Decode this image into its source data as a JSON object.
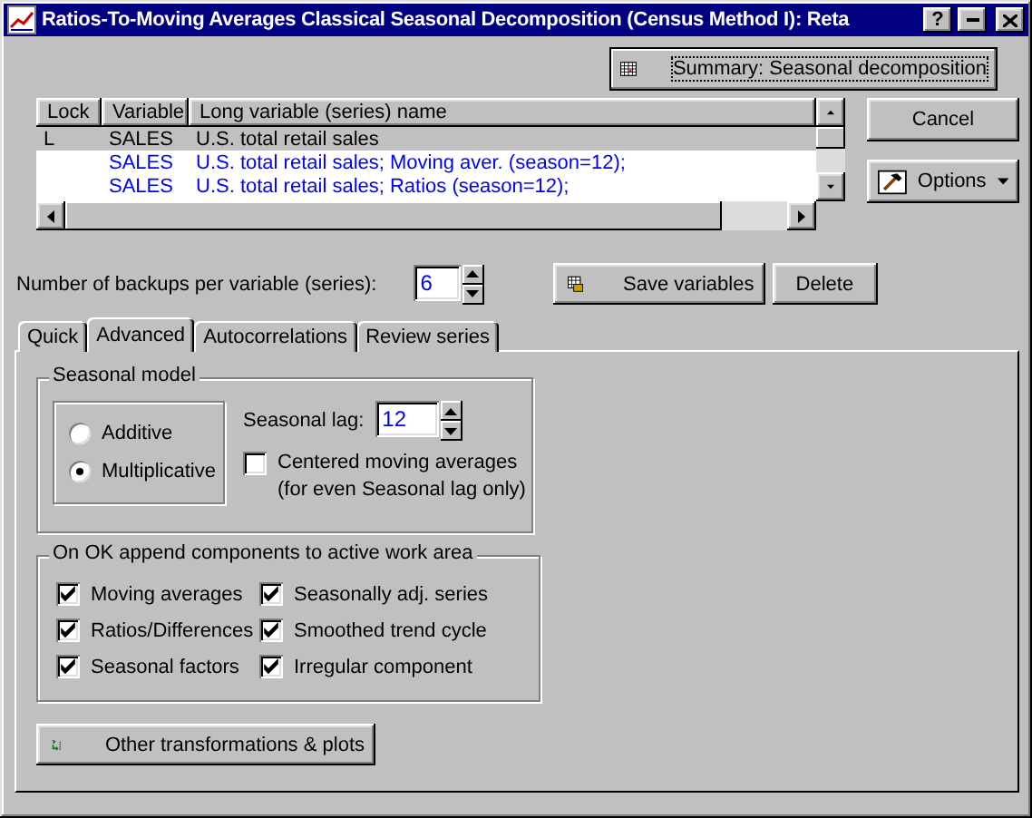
{
  "window": {
    "title": "Ratios-To-Moving Averages Classical Seasonal Decomposition (Census Method I): Reta",
    "help": "?"
  },
  "summary_button": "Summary:  Seasonal decomposition",
  "variables": {
    "columns": [
      "Lock",
      "Variable",
      "Long variable (series) name"
    ],
    "rows": [
      {
        "lock": "L",
        "variable": "SALES",
        "name": "U.S. total retail sales",
        "kind": "original",
        "selected": true
      },
      {
        "variable": "SALES",
        "name": "U.S. total retail sales; Moving aver. (season=12);",
        "kind": "new",
        "selected": false
      },
      {
        "variable": "SALES",
        "name": "U.S. total retail sales; Ratios (season=12);",
        "kind": "new",
        "selected": false
      }
    ]
  },
  "cancel_button": "Cancel",
  "options_button": "Options",
  "backups": {
    "label": "Number of backups per variable (series):",
    "value": "6"
  },
  "save_button": "Save variables",
  "delete_button": "Delete",
  "tabs": [
    {
      "label": "Quick",
      "selected": false
    },
    {
      "label": "Advanced",
      "selected": true
    },
    {
      "label": "Autocorrelations",
      "selected": false
    },
    {
      "label": "Review series",
      "selected": false
    }
  ],
  "seasonal_model": {
    "title": "Seasonal model",
    "options": [
      {
        "label": "Additive",
        "selected": false
      },
      {
        "label": "Multiplicative",
        "selected": true
      }
    ],
    "lag_label": "Seasonal lag:",
    "lag_value": "12",
    "centered": {
      "label": "Centered moving averages",
      "note": "(for even Seasonal lag only)",
      "checked": false
    }
  },
  "components": {
    "title": "On OK append components to active work area",
    "items": [
      {
        "label": "Moving averages",
        "checked": true
      },
      {
        "label": "Seasonally adj. series",
        "checked": true
      },
      {
        "label": "Ratios/Differences",
        "checked": true
      },
      {
        "label": "Smoothed trend cycle",
        "checked": true
      },
      {
        "label": "Seasonal factors",
        "checked": true
      },
      {
        "label": "Irregular component",
        "checked": true
      }
    ]
  },
  "other_button": "Other transformations & plots"
}
